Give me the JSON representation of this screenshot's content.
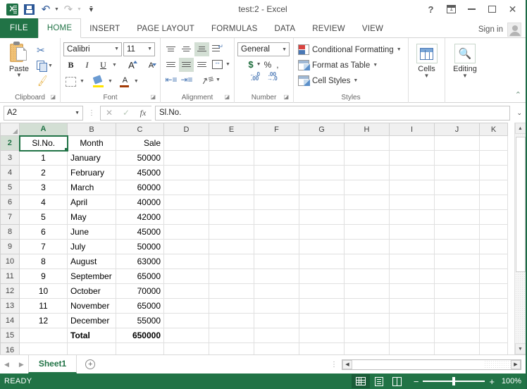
{
  "window": {
    "title": "test:2 - Excel",
    "quick_access": [
      {
        "name": "excel-logo",
        "label": "X"
      },
      {
        "name": "save",
        "label": "Save"
      },
      {
        "name": "undo",
        "label": "Undo"
      },
      {
        "name": "redo",
        "label": "Redo"
      },
      {
        "name": "customize",
        "label": "Customize Quick Access Toolbar"
      }
    ],
    "controls": [
      {
        "name": "help",
        "label": "?"
      },
      {
        "name": "ribbon-display-options",
        "label": "Ribbon Display Options"
      },
      {
        "name": "minimize",
        "label": "Minimize"
      },
      {
        "name": "restore",
        "label": "Restore Down"
      },
      {
        "name": "close",
        "label": "Close"
      }
    ]
  },
  "ribbon": {
    "tabs": [
      {
        "label": "FILE",
        "active": false
      },
      {
        "label": "HOME",
        "active": true
      },
      {
        "label": "INSERT",
        "active": false
      },
      {
        "label": "PAGE LAYOUT",
        "active": false
      },
      {
        "label": "FORMULAS",
        "active": false
      },
      {
        "label": "DATA",
        "active": false
      },
      {
        "label": "REVIEW",
        "active": false
      },
      {
        "label": "VIEW",
        "active": false
      }
    ],
    "sign_in": "Sign in",
    "groups": {
      "clipboard": {
        "label": "Clipboard",
        "paste": "Paste",
        "cut": "Cut",
        "copy": "Copy",
        "format_painter": "Format Painter"
      },
      "font": {
        "label": "Font",
        "font_name": "Calibri",
        "font_size": "11",
        "bold": "B",
        "italic": "I",
        "underline": "U",
        "grow": "A",
        "shrink": "A"
      },
      "alignment": {
        "label": "Alignment"
      },
      "number": {
        "label": "Number",
        "format": "General",
        "currency": "$",
        "percent": "%",
        "comma": ","
      },
      "styles": {
        "label": "Styles",
        "items": [
          "Conditional Formatting",
          "Format as Table",
          "Cell Styles"
        ]
      },
      "cells": {
        "label": "Cells"
      },
      "editing": {
        "label": "Editing"
      }
    }
  },
  "formula_bar": {
    "name_box": "A2",
    "cancel": "✕",
    "enter": "✓",
    "insert_function": "fx",
    "content": "Sl.No."
  },
  "grid": {
    "columns": [
      "A",
      "B",
      "C",
      "D",
      "E",
      "F",
      "G",
      "H",
      "I",
      "J",
      "K"
    ],
    "selected_column": "A",
    "selected_row": "2",
    "selected_cell": "A2",
    "rows": [
      {
        "header": "2",
        "cells": [
          "Sl.No.",
          "Month",
          "Sale",
          "",
          "",
          "",
          "",
          "",
          "",
          "",
          ""
        ],
        "style": "header"
      },
      {
        "header": "3",
        "cells": [
          "1",
          "January",
          "50000",
          "",
          "",
          "",
          "",
          "",
          "",
          "",
          ""
        ]
      },
      {
        "header": "4",
        "cells": [
          "2",
          "February",
          "45000",
          "",
          "",
          "",
          "",
          "",
          "",
          "",
          ""
        ]
      },
      {
        "header": "5",
        "cells": [
          "3",
          "March",
          "60000",
          "",
          "",
          "",
          "",
          "",
          "",
          "",
          ""
        ]
      },
      {
        "header": "6",
        "cells": [
          "4",
          "April",
          "40000",
          "",
          "",
          "",
          "",
          "",
          "",
          "",
          ""
        ]
      },
      {
        "header": "7",
        "cells": [
          "5",
          "May",
          "42000",
          "",
          "",
          "",
          "",
          "",
          "",
          "",
          ""
        ]
      },
      {
        "header": "8",
        "cells": [
          "6",
          "June",
          "45000",
          "",
          "",
          "",
          "",
          "",
          "",
          "",
          ""
        ]
      },
      {
        "header": "9",
        "cells": [
          "7",
          "July",
          "50000",
          "",
          "",
          "",
          "",
          "",
          "",
          "",
          ""
        ]
      },
      {
        "header": "10",
        "cells": [
          "8",
          "August",
          "63000",
          "",
          "",
          "",
          "",
          "",
          "",
          "",
          ""
        ]
      },
      {
        "header": "11",
        "cells": [
          "9",
          "September",
          "65000",
          "",
          "",
          "",
          "",
          "",
          "",
          "",
          ""
        ]
      },
      {
        "header": "12",
        "cells": [
          "10",
          "October",
          "70000",
          "",
          "",
          "",
          "",
          "",
          "",
          "",
          ""
        ]
      },
      {
        "header": "13",
        "cells": [
          "11",
          "November",
          "65000",
          "",
          "",
          "",
          "",
          "",
          "",
          "",
          ""
        ]
      },
      {
        "header": "14",
        "cells": [
          "12",
          "December",
          "55000",
          "",
          "",
          "",
          "",
          "",
          "",
          "",
          ""
        ]
      },
      {
        "header": "15",
        "cells": [
          "",
          "Total",
          "650000",
          "",
          "",
          "",
          "",
          "",
          "",
          "",
          ""
        ],
        "style": "total"
      },
      {
        "header": "16",
        "cells": [
          "",
          "",
          "",
          "",
          "",
          "",
          "",
          "",
          "",
          "",
          ""
        ]
      }
    ]
  },
  "sheet_tabs": {
    "prev": "◀",
    "next": "▶",
    "tabs": [
      {
        "label": "Sheet1",
        "active": true
      }
    ],
    "add": "+"
  },
  "status_bar": {
    "mode": "READY",
    "views": [
      {
        "name": "normal-view",
        "label": "Normal",
        "active": true
      },
      {
        "name": "page-layout-view",
        "label": "Page Layout",
        "active": false
      },
      {
        "name": "page-break-preview",
        "label": "Page Break Preview",
        "active": false
      }
    ],
    "zoom_out": "−",
    "zoom_in": "+",
    "zoom": "100%"
  },
  "colors": {
    "excel_green": "#217346",
    "dark_green": "#1a5c38",
    "selection": "#d3dfd4"
  }
}
